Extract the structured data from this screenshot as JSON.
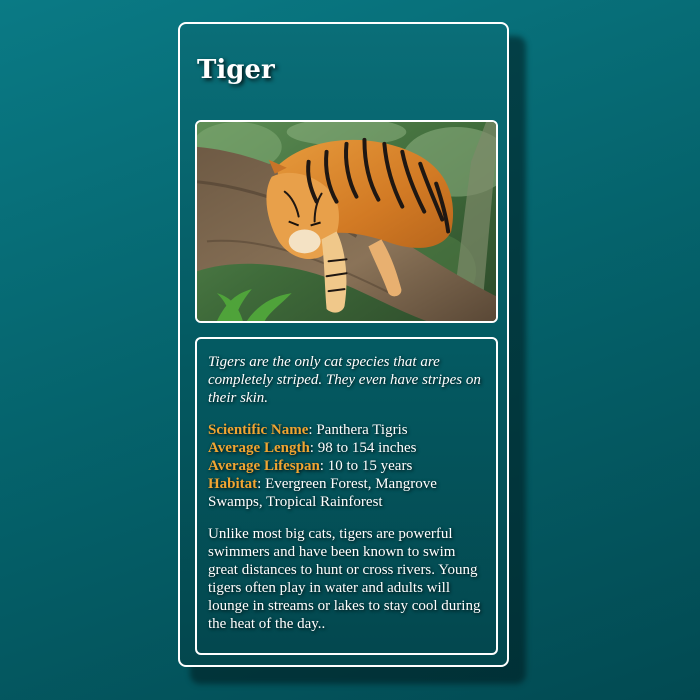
{
  "card": {
    "title": "Tiger",
    "image": {
      "subject": "tiger-resting-on-tree-branch"
    },
    "intro": "Tigers are the only cat species that are completely striped. They even have stripes on their skin.",
    "facts": [
      {
        "label": "Scientific Name",
        "value": "Panthera Tigris"
      },
      {
        "label": "Average Length",
        "value": "98 to 154 inches"
      },
      {
        "label": "Average Lifespan",
        "value": "10 to 15 years"
      },
      {
        "label": "Habitat",
        "value": "Evergreen Forest, Mangrove Swamps, Tropical Rainforest"
      }
    ],
    "separator": ": ",
    "description": "Unlike most big cats, tigers are powerful swimmers and have been known to swim great distances to hunt or cross rivers. Young tigers often play in water and adults will lounge in streams or lakes to stay cool during the heat of the day.."
  },
  "colors": {
    "background": "#05646d",
    "card_border": "#ffffff",
    "label_accent": "#f0a532",
    "text": "#ffffff"
  }
}
